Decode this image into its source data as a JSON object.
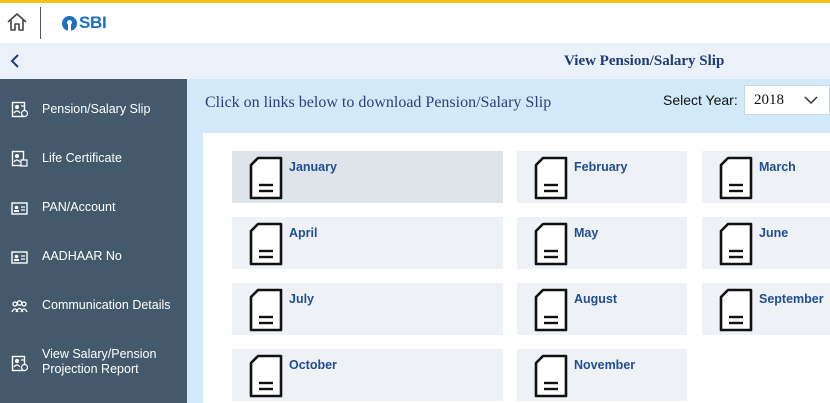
{
  "header": {
    "logo_text": "SBI",
    "icons": {
      "home": "home-icon",
      "logo": "sbi-logo-icon"
    },
    "accent_color": "#f5c218",
    "brand_color": "#1d6fc6"
  },
  "sidebar": {
    "back_icon": "chevron-left-icon",
    "background_color": "#44596b",
    "items": [
      {
        "label": "Pension/Salary Slip",
        "icon": "salary-slip-icon"
      },
      {
        "label": "Life Certificate",
        "icon": "life-certificate-icon"
      },
      {
        "label": "PAN/Account",
        "icon": "id-card-icon"
      },
      {
        "label": "AADHAAR No",
        "icon": "id-card-icon"
      },
      {
        "label": "Communication Details",
        "icon": "people-icon"
      },
      {
        "label": "View Salary/Pension Projection Report",
        "icon": "report-icon"
      }
    ]
  },
  "main": {
    "title": "View Pension/Salary Slip",
    "instruction": "Click on links below to download Pension/Salary Slip",
    "year_select": {
      "label": "Select Year:",
      "value": "2018",
      "icon": "chevron-down-icon"
    },
    "month_icon": "document-icon",
    "months": [
      {
        "label": "January",
        "active": true
      },
      {
        "label": "February"
      },
      {
        "label": "March"
      },
      {
        "label": "April"
      },
      {
        "label": "May"
      },
      {
        "label": "June"
      },
      {
        "label": "July"
      },
      {
        "label": "August"
      },
      {
        "label": "September"
      },
      {
        "label": "October"
      },
      {
        "label": "November"
      }
    ]
  }
}
